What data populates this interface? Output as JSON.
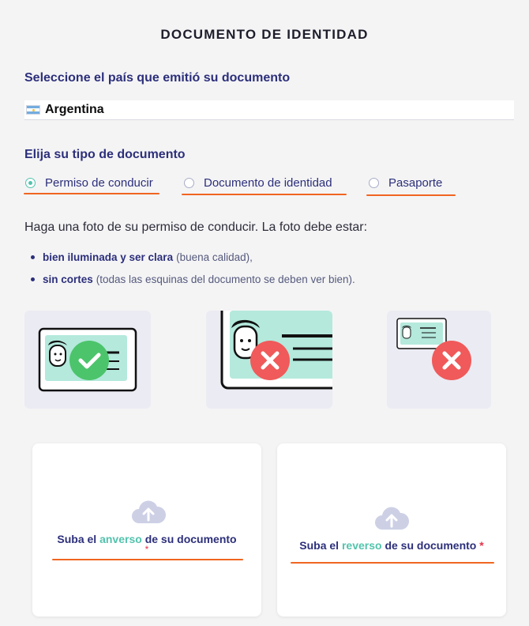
{
  "title": "DOCUMENTO DE IDENTIDAD",
  "country_section": {
    "label": "Seleccione el país que emitió su documento",
    "selected_country": "Argentina",
    "flag_colors": [
      "#74acdf",
      "#ffffff",
      "#74acdf"
    ]
  },
  "doc_type_section": {
    "label": "Elija su tipo de documento",
    "options": [
      {
        "label": "Permiso de conducir",
        "selected": true
      },
      {
        "label": "Documento de identidad",
        "selected": false
      },
      {
        "label": "Pasaporte",
        "selected": false
      }
    ]
  },
  "instructions": {
    "text": "Haga una foto de su permiso de conducir. La foto debe estar:",
    "bullets": [
      {
        "bold": "bien iluminada y ser clara",
        "rest": "(buena calidad),"
      },
      {
        "bold": "sin cortes",
        "rest": "(todas las esquinas del documento se deben ver bien)."
      }
    ]
  },
  "examples": [
    {
      "status": "ok",
      "icon": "check-icon"
    },
    {
      "status": "bad",
      "icon": "cross-icon"
    },
    {
      "status": "bad",
      "icon": "cross-icon"
    }
  ],
  "upload": {
    "front": {
      "prefix": "Suba el",
      "highlight": "anverso",
      "suffix": "de su documento",
      "required": "*"
    },
    "back": {
      "prefix": "Suba el",
      "highlight": "reverso",
      "suffix": "de su documento",
      "required": "*"
    }
  },
  "colors": {
    "accent": "#53c3ad",
    "brand": "#2c2f7a",
    "annotation": "#f06521",
    "error": "#f05a5a",
    "success": "#4cc46b"
  }
}
